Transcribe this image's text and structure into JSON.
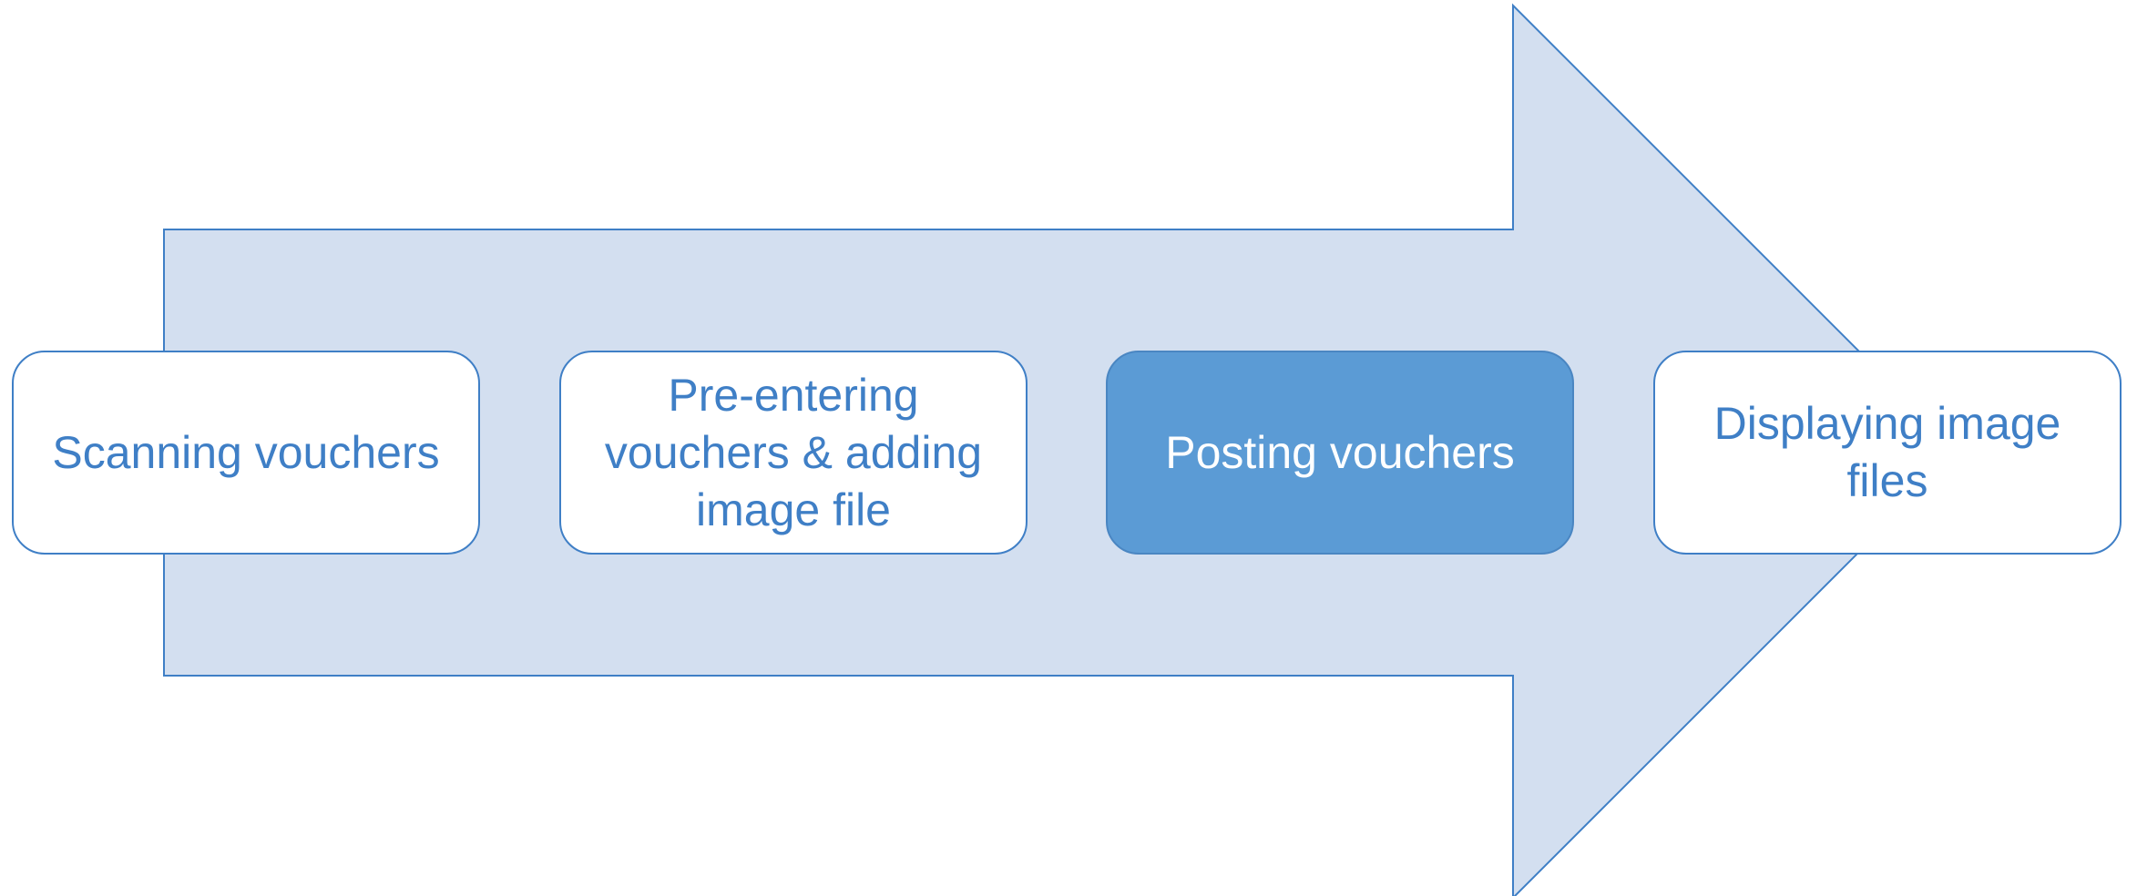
{
  "colors": {
    "arrow_fill": "#d3dff0",
    "arrow_stroke": "#3f7fc6",
    "box_border": "#3f7fc6",
    "box_text": "#3f7fc6",
    "active_fill": "#5b9bd5",
    "active_text": "#ffffff"
  },
  "process": {
    "steps": [
      {
        "label": "Scanning vouchers",
        "active": false
      },
      {
        "label": "Pre-entering vouchers & adding image file",
        "active": false
      },
      {
        "label": "Posting vouchers",
        "active": true
      },
      {
        "label": "Displaying image files",
        "active": false
      }
    ]
  }
}
